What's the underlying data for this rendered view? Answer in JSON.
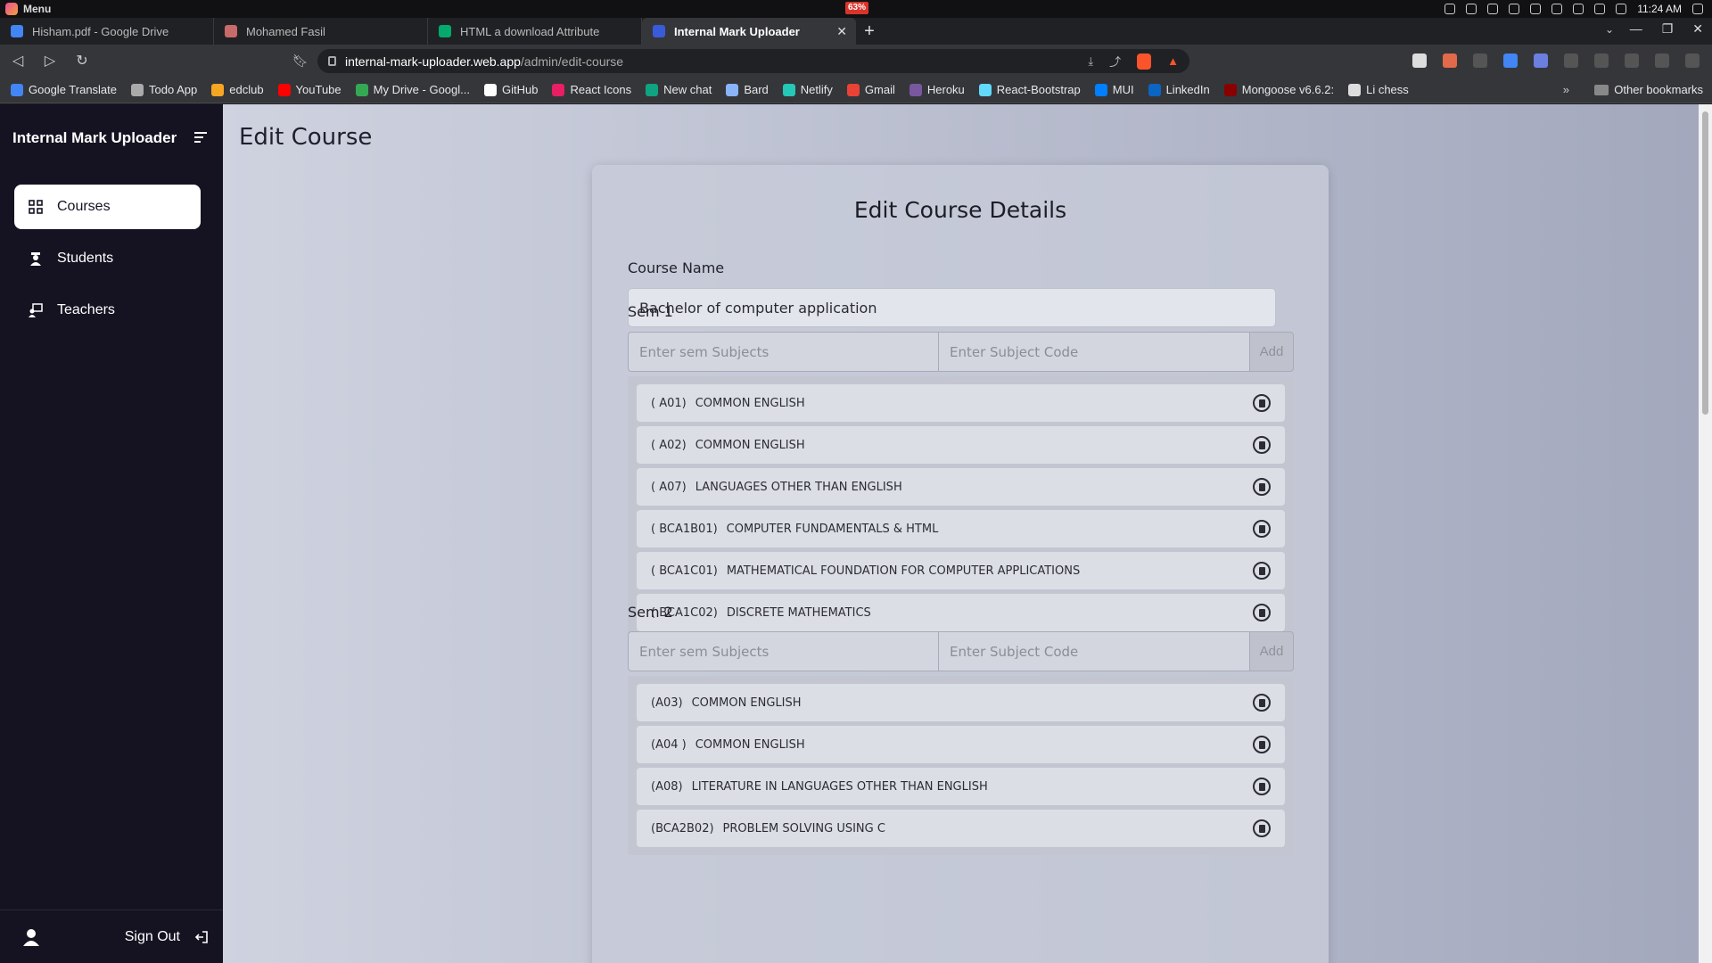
{
  "os": {
    "menu_label": "Menu",
    "battery": "63%",
    "clock": "11:24 AM"
  },
  "tabs": [
    {
      "title": "Hisham.pdf - Google Drive",
      "color": "#4285f4"
    },
    {
      "title": "Mohamed Fasil",
      "color": "#c76a6a"
    },
    {
      "title": "HTML a download Attribute",
      "color": "#04aa6d"
    },
    {
      "title": "Internal Mark Uploader",
      "color": "#3a5bd9",
      "active": true
    }
  ],
  "address": {
    "host": "internal-mark-uploader.web.app",
    "path": "/admin/edit-course"
  },
  "bookmarks": [
    {
      "label": "Google Translate",
      "color": "#4285f4"
    },
    {
      "label": "Todo App",
      "color": "#aaaaaa"
    },
    {
      "label": "edclub",
      "color": "#f5a623"
    },
    {
      "label": "YouTube",
      "color": "#ff0000"
    },
    {
      "label": "My Drive - Googl...",
      "color": "#34a853"
    },
    {
      "label": "GitHub",
      "color": "#ffffff"
    },
    {
      "label": "React Icons",
      "color": "#e91e63"
    },
    {
      "label": "New chat",
      "color": "#10a37f"
    },
    {
      "label": "Bard",
      "color": "#8ab4f8"
    },
    {
      "label": "Netlify",
      "color": "#25c7b7"
    },
    {
      "label": "Gmail",
      "color": "#ea4335"
    },
    {
      "label": "Heroku",
      "color": "#79589f"
    },
    {
      "label": "React-Bootstrap",
      "color": "#61dafb"
    },
    {
      "label": "MUI",
      "color": "#007fff"
    },
    {
      "label": "LinkedIn",
      "color": "#0a66c2"
    },
    {
      "label": "Mongoose v6.6.2:",
      "color": "#880000"
    },
    {
      "label": "Li chess",
      "color": "#dddddd"
    }
  ],
  "bookmarks_other": "Other bookmarks",
  "sidebar": {
    "brand": "Internal Mark Uploader",
    "items": [
      {
        "label": "Courses",
        "icon": "grid-icon",
        "active": true
      },
      {
        "label": "Students",
        "icon": "student-icon"
      },
      {
        "label": "Teachers",
        "icon": "teacher-icon"
      }
    ],
    "signout": "Sign Out"
  },
  "page": {
    "title": "Edit Course",
    "card_title": "Edit Course Details",
    "course_name_label": "Course Name",
    "course_name_value": "Bachelor of computer application",
    "subject_placeholder": "Enter sem Subjects",
    "code_placeholder": "Enter Subject Code",
    "add_label": "Add"
  },
  "semesters": [
    {
      "label": "Sem 1",
      "subjects": [
        {
          "code": "( A01)",
          "name": "COMMON ENGLISH"
        },
        {
          "code": "( A02)",
          "name": "COMMON ENGLISH"
        },
        {
          "code": "( A07)",
          "name": "LANGUAGES OTHER THAN ENGLISH"
        },
        {
          "code": "( BCA1B01)",
          "name": "COMPUTER FUNDAMENTALS & HTML"
        },
        {
          "code": "( BCA1C01)",
          "name": "MATHEMATICAL FOUNDATION FOR COMPUTER APPLICATIONS"
        },
        {
          "code": "( BCA1C02)",
          "name": "DISCRETE MATHEMATICS"
        }
      ]
    },
    {
      "label": "Sem 2",
      "subjects": [
        {
          "code": "(A03)",
          "name": "COMMON ENGLISH"
        },
        {
          "code": "(A04 )",
          "name": "COMMON ENGLISH"
        },
        {
          "code": "(A08)",
          "name": "LITERATURE IN LANGUAGES OTHER THAN ENGLISH"
        },
        {
          "code": "(BCA2B02)",
          "name": "PROBLEM SOLVING USING C"
        }
      ]
    }
  ]
}
